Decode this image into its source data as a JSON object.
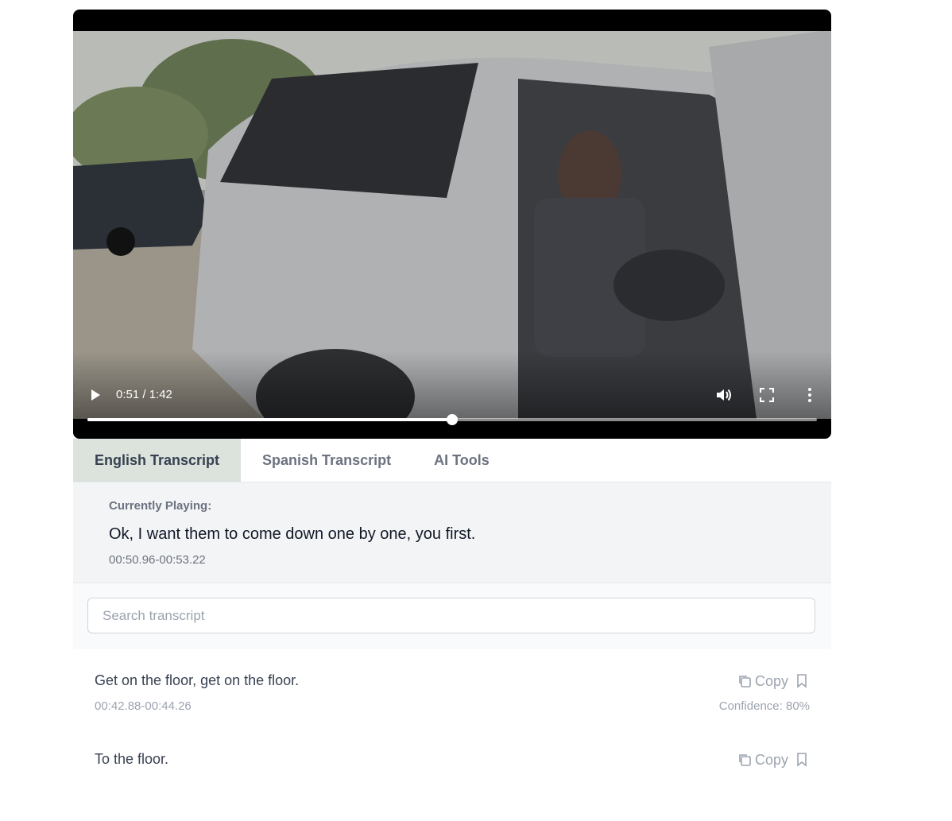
{
  "video": {
    "time_display": "0:51 / 1:42",
    "progress": 0.5,
    "icons": {
      "play": "play-icon",
      "volume": "volume-icon",
      "fullscreen": "fullscreen-icon",
      "more": "more-options-icon"
    }
  },
  "tabs": [
    {
      "label": "English Transcript",
      "active": true
    },
    {
      "label": "Spanish Transcript",
      "active": false
    },
    {
      "label": "AI Tools",
      "active": false
    }
  ],
  "now_playing": {
    "label": "Currently Playing:",
    "text": "Ok, I want them to come down one by one, you first.",
    "time": "00:50.96-00:53.22"
  },
  "search": {
    "placeholder": "Search transcript",
    "value": ""
  },
  "entries": [
    {
      "text": "Get on the floor, get on the floor.",
      "time": "00:42.88-00:44.26",
      "copy_label": "Copy",
      "confidence": "Confidence: 80%"
    },
    {
      "text": "To the floor.",
      "time": "",
      "copy_label": "Copy",
      "confidence": ""
    }
  ],
  "colors": {
    "active_tab_bg": "#dbe3dc",
    "panel_bg": "#f3f4f6"
  }
}
